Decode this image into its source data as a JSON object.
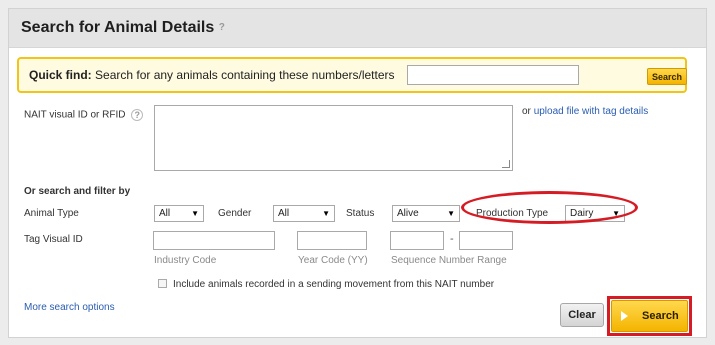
{
  "header": {
    "title": "Search for Animal Details",
    "help": "?"
  },
  "quick_find": {
    "label_bold": "Quick find:",
    "label_text": "Search for any animals containing these numbers/letters",
    "input_value": "",
    "button": "Search"
  },
  "nait": {
    "label": "NAIT visual ID or RFID",
    "help": "?",
    "textarea_value": "",
    "or_text": "or",
    "upload_link": "upload file with tag details"
  },
  "filter": {
    "heading": "Or search and filter by",
    "animal_type": {
      "label": "Animal Type",
      "value": "All"
    },
    "gender": {
      "label": "Gender",
      "value": "All"
    },
    "status": {
      "label": "Status",
      "value": "Alive"
    },
    "production_type": {
      "label": "Production Type",
      "value": "Dairy"
    }
  },
  "tag": {
    "label": "Tag Visual ID",
    "industry_code_hint": "Industry Code",
    "year_code_hint": "Year Code (YY)",
    "sequence_hint": "Sequence Number Range",
    "dash": "-"
  },
  "checkbox": {
    "label": "Include animals recorded in a sending movement from this NAIT number",
    "checked": false
  },
  "more_options": "More search options",
  "buttons": {
    "clear": "Clear",
    "search": "Search"
  },
  "colors": {
    "accent_yellow": "#f4b400",
    "highlight_red": "#d51c24",
    "link_blue": "#2a5db0"
  }
}
